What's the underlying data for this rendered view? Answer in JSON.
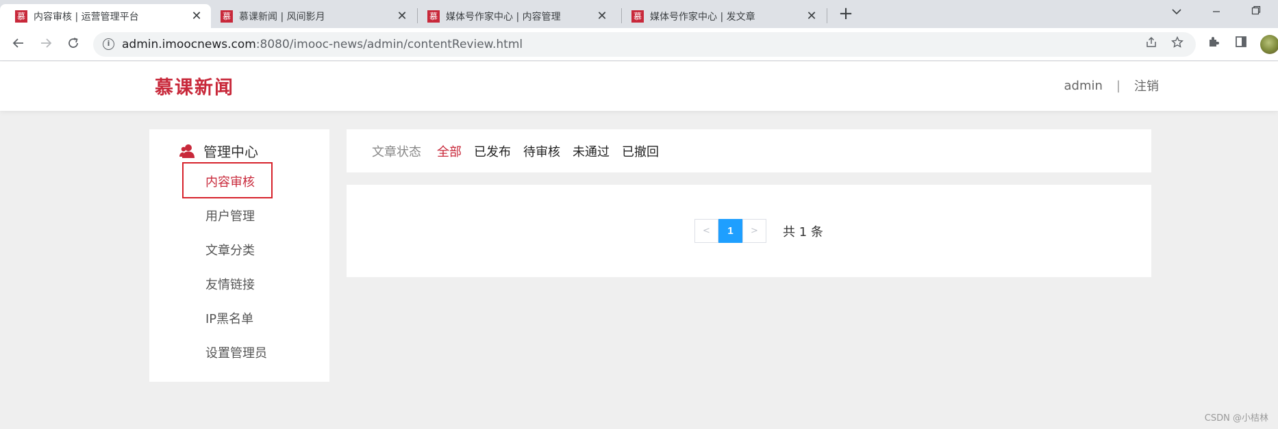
{
  "browser": {
    "tabs": [
      {
        "favicon": "慕",
        "title": "内容审核 | 运营管理平台",
        "active": true
      },
      {
        "favicon": "慕",
        "title": "慕课新闻 | 风间影月",
        "active": false
      },
      {
        "favicon": "慕",
        "title": "媒体号作家中心 | 内容管理",
        "active": false
      },
      {
        "favicon": "慕",
        "title": "媒体号作家中心 | 发文章",
        "active": false
      }
    ],
    "close_glyph": "✕",
    "new_tab_glyph": "+",
    "url_host": "admin.imoocnews.com",
    "url_rest": ":8080/imooc-news/admin/contentReview.html"
  },
  "header": {
    "logo": "慕课新闻",
    "username": "admin",
    "divider": "|",
    "logout": "注销"
  },
  "sidebar": {
    "title": "管理中心",
    "items": [
      {
        "label": "内容审核",
        "active": true
      },
      {
        "label": "用户管理",
        "active": false
      },
      {
        "label": "文章分类",
        "active": false
      },
      {
        "label": "友情链接",
        "active": false
      },
      {
        "label": "IP黑名单",
        "active": false
      },
      {
        "label": "设置管理员",
        "active": false
      }
    ]
  },
  "filter": {
    "label": "文章状态",
    "tabs": [
      {
        "label": "全部",
        "active": true
      },
      {
        "label": "已发布",
        "active": false
      },
      {
        "label": "待审核",
        "active": false
      },
      {
        "label": "未通过",
        "active": false
      },
      {
        "label": "已撤回",
        "active": false
      }
    ]
  },
  "pagination": {
    "prev": "<",
    "current": "1",
    "next": ">",
    "total": "共 1 条"
  },
  "watermark": "CSDN @小桔林",
  "colors": {
    "brand_red": "#c8283a",
    "highlight_border": "#d6222b",
    "page_active": "#1e9fff",
    "background": "#efefef"
  }
}
